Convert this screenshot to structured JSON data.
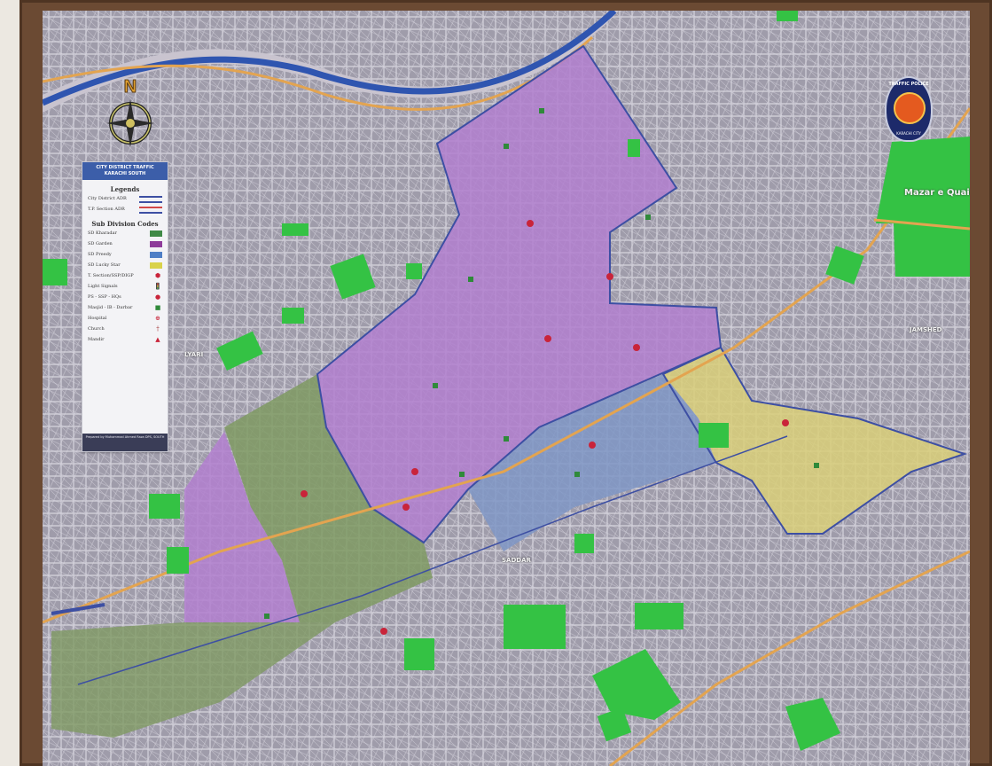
{
  "legend": {
    "header": "CITY DISTRICT TRAFFIC KARACHI SOUTH",
    "title": "Legends",
    "lines": [
      {
        "label": "City District ADR",
        "color": "#3d4fa3"
      },
      {
        "label": "T.P. Section ADR",
        "color": "#d24848"
      }
    ],
    "subdivision_title": "Sub Division Codes",
    "subdivisions": [
      {
        "label": "SD Kharadar",
        "color": "#3f8a46"
      },
      {
        "label": "SD Garden",
        "color": "#8e3b9a"
      },
      {
        "label": "SD Preedy",
        "color": "#4f7fc6"
      },
      {
        "label": "SD Lucky Star",
        "color": "#d9d24a"
      }
    ],
    "symbols": [
      {
        "label": "T. Section/SSP/DIGP",
        "icon": "shield-icon"
      },
      {
        "label": "Light Signals",
        "icon": "traffic-light-icon"
      },
      {
        "label": "PS - SSP - HQs",
        "icon": "police-badge-icon"
      },
      {
        "label": "Masjid - IB - Darbar",
        "icon": "mosque-icon"
      },
      {
        "label": "Hospital",
        "icon": "hospital-icon"
      },
      {
        "label": "Church",
        "icon": "church-icon"
      },
      {
        "label": "Mandir",
        "icon": "temple-icon"
      }
    ],
    "footer": "Prepared by Muhammad Ahmed Raza DPS, SOUTH"
  },
  "compass": {
    "label": "N"
  },
  "emblem": {
    "top_text": "TRAFFIC POLICE",
    "bottom_text": "KARACHI CITY"
  },
  "places": {
    "mazar": "Mazar e Quaid",
    "jamshed": "JAMSHED",
    "lyari": "LYARI",
    "saddar": "SADDAR"
  },
  "colors": {
    "base_map": "#a9a6b2",
    "frame": "#6b4a33",
    "river": "#2f55b0",
    "park": "#34c244",
    "garden": "#b27fcf",
    "kharadar": "#7f9a63",
    "preedy": "#7f96c6",
    "lucky_star": "#d9cf79",
    "orange_roads": "#e3a450"
  }
}
